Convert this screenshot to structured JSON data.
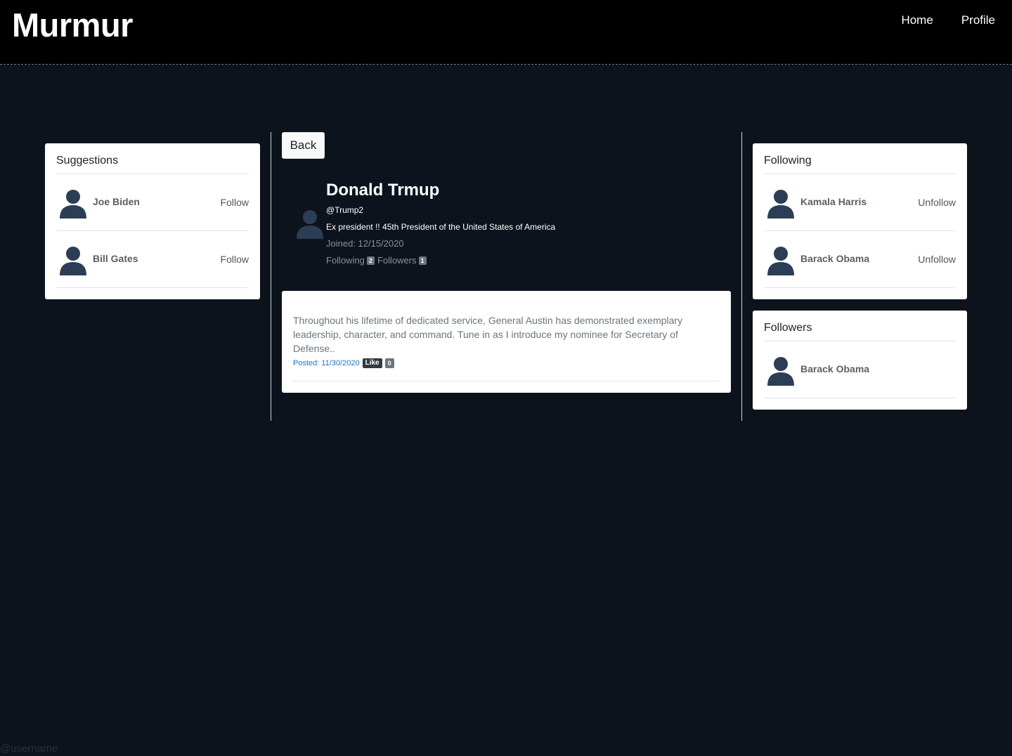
{
  "brand": "Murmur",
  "nav": {
    "home": "Home",
    "profile": "Profile"
  },
  "suggestions": {
    "title": "Suggestions",
    "users": [
      {
        "name": "Joe Biden",
        "action": "Follow"
      },
      {
        "name": "Bill Gates",
        "action": "Follow"
      }
    ]
  },
  "profile": {
    "back_label": "Back",
    "name": "Donald Trmup",
    "handle": "@Trump2",
    "bio": "Ex president !! 45th President of the United States of America",
    "joined": "Joined: 12/15/2020",
    "following_label": "Following",
    "following_count": "2",
    "followers_label": "Followers",
    "followers_count": "1"
  },
  "post": {
    "text": "Throughout his lifetime of dedicated service, General Austin has demonstrated exemplary leadership, character, and command. Tune in as I introduce my nominee for Secretary of Defense..",
    "posted": "Posted: 11/30/2020",
    "like_label": "Like",
    "like_count": "0"
  },
  "following": {
    "title": "Following",
    "users": [
      {
        "name": "Kamala Harris",
        "action": "Unfollow"
      },
      {
        "name": "Barack Obama",
        "action": "Unfollow"
      }
    ]
  },
  "followers": {
    "title": "Followers",
    "users": [
      {
        "name": "Barack Obama"
      }
    ]
  },
  "footer": {
    "username_placeholder": "@username"
  },
  "colors": {
    "background": "#0d131c",
    "topbar": "#000000",
    "avatar": "#2c3e55",
    "link": "#1a73c9"
  }
}
